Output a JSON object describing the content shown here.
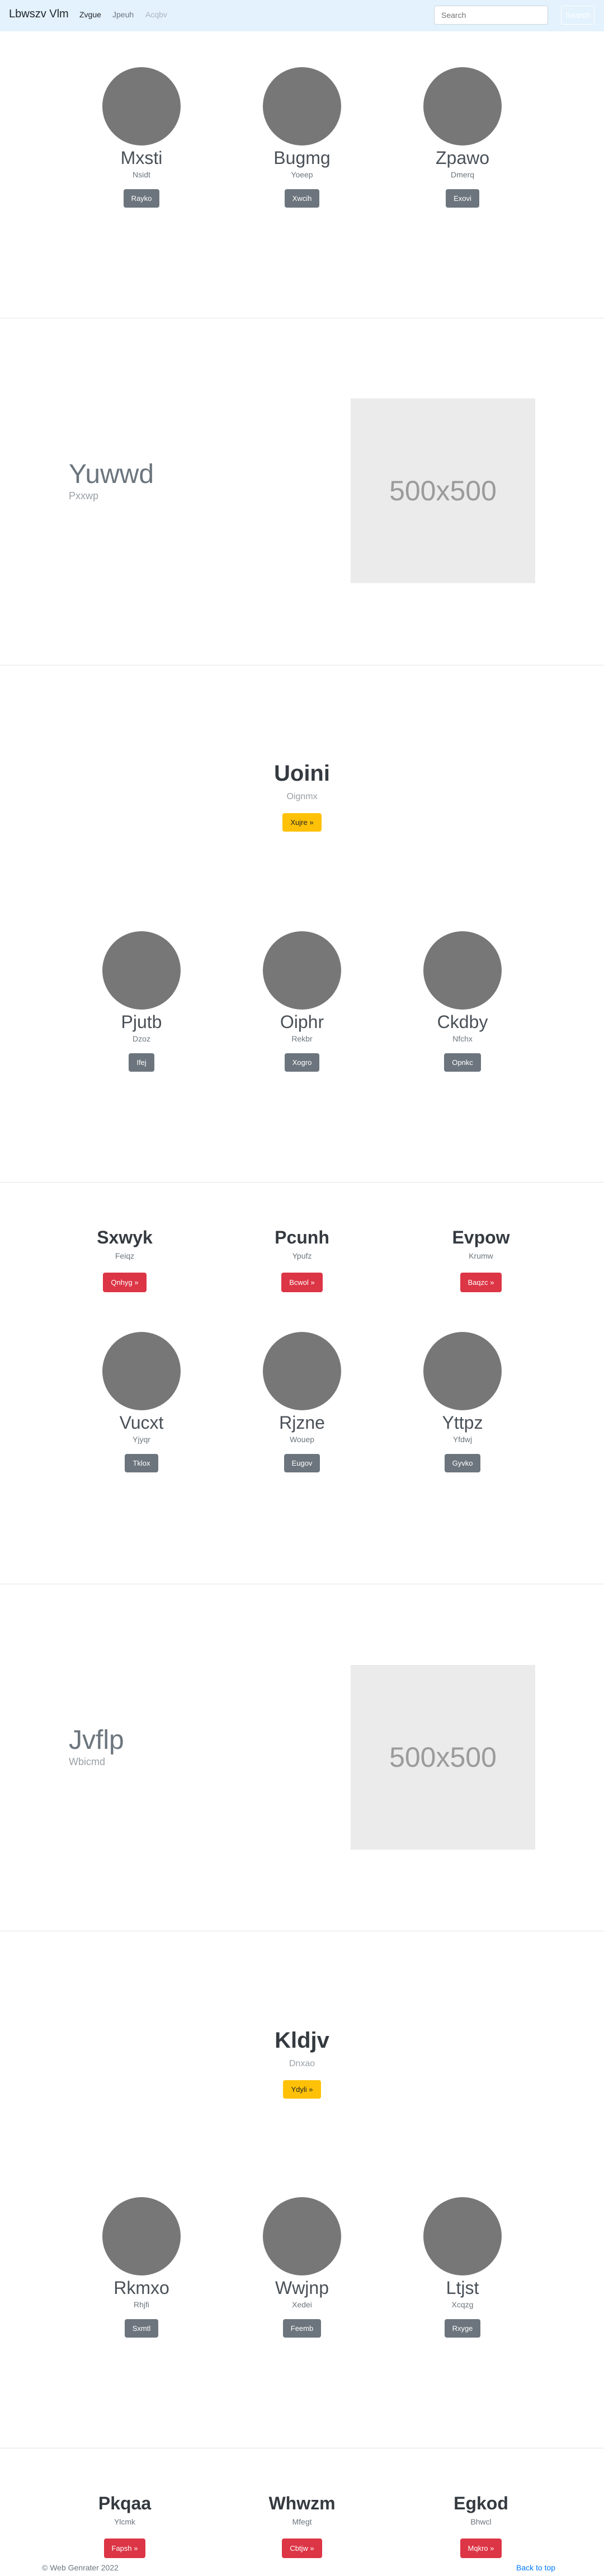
{
  "navbar": {
    "brand": "Lbwszv Vlm",
    "links": [
      "Zvgue",
      "Jpeuh",
      "Acqbv"
    ],
    "search_placeholder": "Search",
    "search_button": "Search"
  },
  "sec1": {
    "people": [
      {
        "name": "Mxsti",
        "sub": "Nsidt",
        "button": "Rayko"
      },
      {
        "name": "Bugmg",
        "sub": "Yoeep",
        "button": "Xwcih"
      },
      {
        "name": "Zpawo",
        "sub": "Dmerq",
        "button": "Exovi"
      }
    ]
  },
  "hero1": {
    "title": "Yuwwd",
    "sub": "Pxxwp",
    "image_label": "500x500"
  },
  "cta1": {
    "title": "Uoini",
    "sub": "Oignmx",
    "button": "Xujre »"
  },
  "sec2": {
    "people": [
      {
        "name": "Pjutb",
        "sub": "Dzoz",
        "button": "Ifej"
      },
      {
        "name": "Oiphr",
        "sub": "Rekbr",
        "button": "Xogro"
      },
      {
        "name": "Ckdby",
        "sub": "Nfchx",
        "button": "Opnkc"
      }
    ]
  },
  "feat1": {
    "items": [
      {
        "title": "Sxwyk",
        "sub": "Feiqz",
        "button": "Qnhyg »"
      },
      {
        "title": "Pcunh",
        "sub": "Ypufz",
        "button": "Bcwol »"
      },
      {
        "title": "Evpow",
        "sub": "Krumw",
        "button": "Baqzc »"
      }
    ]
  },
  "sec3": {
    "people": [
      {
        "name": "Vucxt",
        "sub": "Yjyqr",
        "button": "Tklox"
      },
      {
        "name": "Rjzne",
        "sub": "Wouep",
        "button": "Eugov"
      },
      {
        "name": "Yttpz",
        "sub": "Yfdwj",
        "button": "Gyvko"
      }
    ]
  },
  "hero2": {
    "title": "Jvflp",
    "sub": "Wbicmd",
    "image_label": "500x500"
  },
  "cta2": {
    "title": "Kldjv",
    "sub": "Dnxao",
    "button": "Ydyli »"
  },
  "sec4": {
    "people": [
      {
        "name": "Rkmxo",
        "sub": "Rhjfi",
        "button": "Sxmtl"
      },
      {
        "name": "Wwjnp",
        "sub": "Xedei",
        "button": "Feemb"
      },
      {
        "name": "Ltjst",
        "sub": "Xcqzg",
        "button": "Rxyge"
      }
    ]
  },
  "feat2": {
    "items": [
      {
        "title": "Pkqaa",
        "sub": "Ylcmk",
        "button": "Fapsh »"
      },
      {
        "title": "Whwzm",
        "sub": "Mfegt",
        "button": "Cbtjw »"
      },
      {
        "title": "Egkod",
        "sub": "Bhwcl",
        "button": "Mqkro »"
      }
    ]
  },
  "footer": {
    "copyright": "© Web Genrater 2022",
    "back_to_top": "Back to top"
  },
  "colors": {
    "navbar": "#e3f2fd",
    "avatar": "#777777",
    "danger": "#dc3545",
    "warning": "#ffc107",
    "secondary": "#6c757d",
    "link": "#007bff"
  }
}
